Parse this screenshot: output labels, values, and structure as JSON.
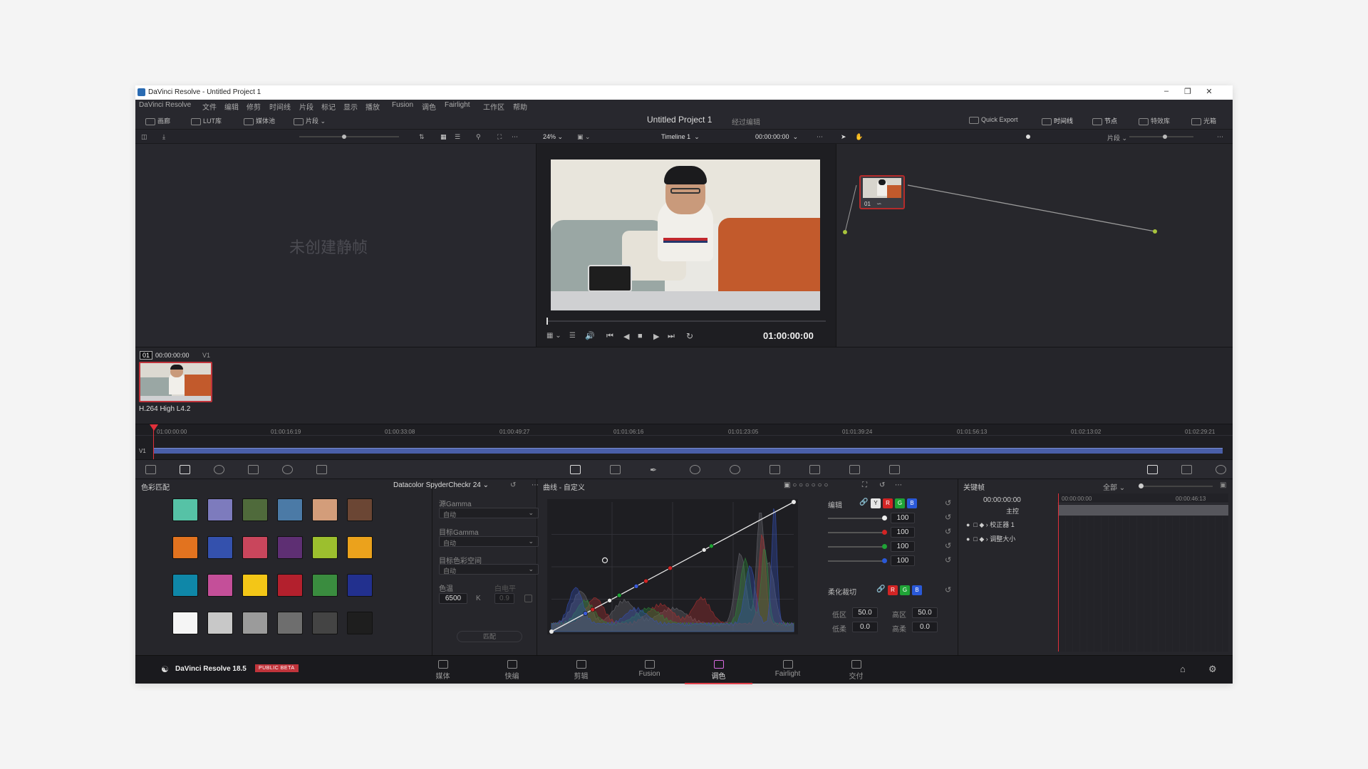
{
  "window": {
    "title": "DaVinci Resolve - Untitled Project 1"
  },
  "menu": [
    "DaVinci Resolve",
    "文件",
    "编辑",
    "修剪",
    "时间线",
    "片段",
    "标记",
    "显示",
    "播放",
    "Fusion",
    "调色",
    "Fairlight",
    "工作区",
    "帮助"
  ],
  "toolbar": {
    "gallery": "画廊",
    "lut": "LUT库",
    "media_pool": "媒体池",
    "clips": "片段",
    "project_title": "Untitled Project 1",
    "project_sub": "经过编辑",
    "quick_export": "Quick Export",
    "timeline": "时间线",
    "nodes": "节点",
    "effects": "特效库",
    "lightbox": "光箱"
  },
  "subbar": {
    "zoom": "24%",
    "timeline_name": "Timeline 1",
    "timecode": "00:00:00:00",
    "clip_mode": "片段"
  },
  "gallery": {
    "empty_text": "未创建静帧"
  },
  "viewer": {
    "timecode": "01:00:00:00"
  },
  "node": {
    "label": "01"
  },
  "clip": {
    "number": "01",
    "timecode": "00:00:00:00",
    "track": "V1",
    "codec": "H.264 High L4.2"
  },
  "mini_timeline": {
    "ticks": [
      "01:00:00:00",
      "01:00:16:19",
      "01:00:33:08",
      "01:00:49:27",
      "01:01:06:16",
      "01:01:23:05",
      "01:01:39:24",
      "01:01:56:13",
      "01:02:13:02",
      "01:02:29:21"
    ],
    "track": "V1"
  },
  "color_match": {
    "title": "色彩匹配",
    "chart": "Datacolor SpyderCheckr 24",
    "source_gamma_label": "源Gamma",
    "source_gamma": "自动",
    "target_gamma_label": "目标Gamma",
    "target_gamma": "自动",
    "target_space_label": "目标色彩空间",
    "target_space": "自动",
    "temp_label": "色温",
    "temp_value": "6500",
    "temp_unit": "K",
    "white_level_label": "白电平",
    "white_level_value": "0.9",
    "match_button": "匹配",
    "swatches": [
      "#56c2a6",
      "#7d7bbd",
      "#4f6a3b",
      "#4b7aa6",
      "#d39d7a",
      "#6b4634",
      "#e2731f",
      "#3451ad",
      "#c9465c",
      "#5e2f73",
      "#9cbf2e",
      "#eba21c",
      "#0f87a8",
      "#c44f99",
      "#f3c617",
      "#b3202d",
      "#3a8c3f",
      "#22308e",
      "#f5f5f5",
      "#c8c8c8",
      "#9b9b9b",
      "#6e6e6e",
      "#444444",
      "#1e1e1e"
    ]
  },
  "curves": {
    "title": "曲线 - 自定义",
    "edit_label": "编辑",
    "channels": [
      "Y",
      "R",
      "G",
      "B"
    ],
    "values": [
      "100",
      "100",
      "100",
      "100"
    ],
    "soft_clip_label": "柔化裁切",
    "low_label": "低区",
    "low_value": "50.0",
    "high_label": "高区",
    "high_value": "50.0",
    "low_soft_label": "低柔",
    "low_soft_value": "0.0",
    "high_soft_label": "高柔",
    "high_soft_value": "0.0"
  },
  "keyframes": {
    "title": "关键帧",
    "filter": "全部",
    "timecode": "00:00:00:00",
    "t0": "00:00:00:00",
    "t1": "00:00:46:13",
    "rows": [
      "主控",
      "校正器 1",
      "调整大小"
    ]
  },
  "bottom": {
    "brand": "DaVinci Resolve 18.5",
    "badge": "PUBLIC BETA",
    "pages": [
      "媒体",
      "快编",
      "剪辑",
      "Fusion",
      "调色",
      "Fairlight",
      "交付"
    ],
    "active_page": 4
  }
}
